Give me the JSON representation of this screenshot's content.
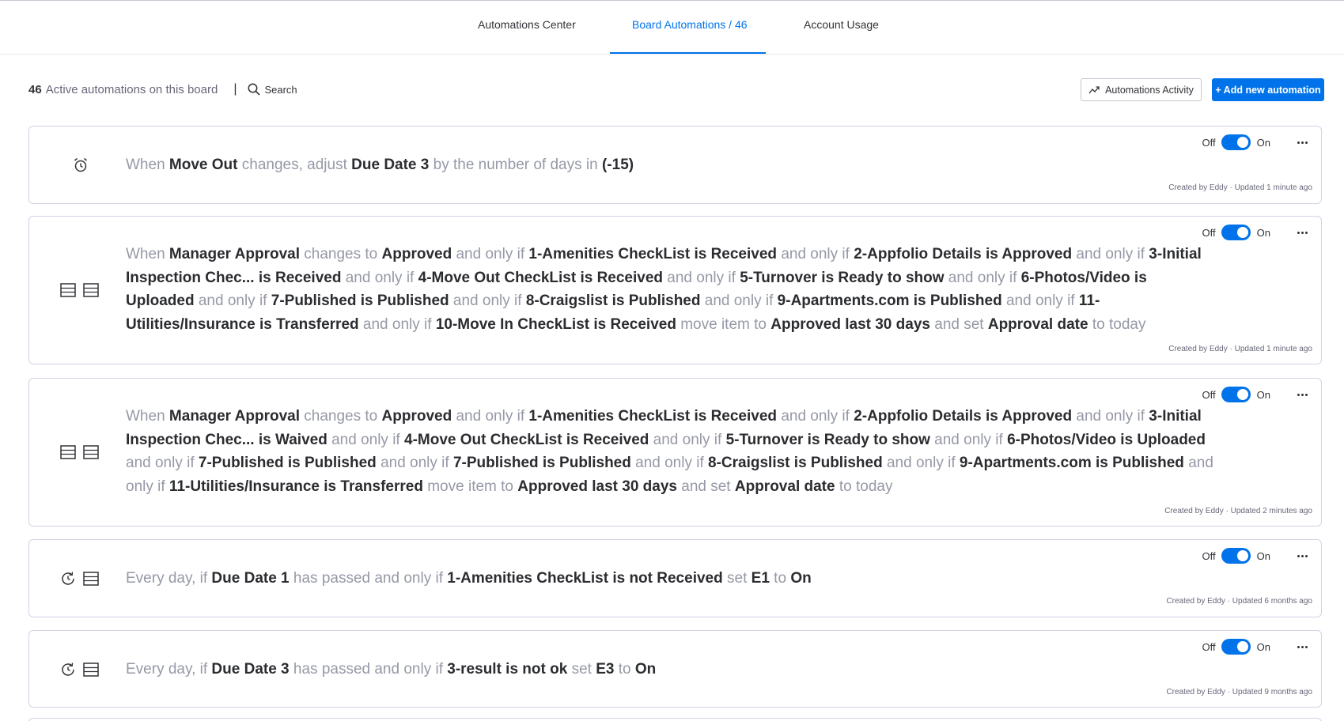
{
  "tabs": [
    {
      "label": "Automations Center"
    },
    {
      "label": "Board Automations / 46"
    },
    {
      "label": "Account Usage"
    }
  ],
  "toolbar": {
    "count": "46",
    "count_text": "Active automations on this board",
    "separator": "|",
    "search_label": "Search",
    "activity_label": "Automations Activity",
    "add_label": "+ Add new automation"
  },
  "toggle": {
    "off_label": "Off",
    "on_label": "On"
  },
  "colors": {
    "accent": "#0073ea",
    "text": "#323338",
    "muted": "#9699a6",
    "border": "#d0d4e4"
  },
  "automations": [
    {
      "icons": [
        "alarm-clock-icon"
      ],
      "enabled": true,
      "sentence": [
        [
          "tx",
          "When"
        ],
        [
          "kw",
          "Move Out"
        ],
        [
          "tx",
          "changes, adjust"
        ],
        [
          "kw",
          "Due Date 3"
        ],
        [
          "tx",
          "by the number of days in"
        ],
        [
          "kw",
          "(-15)"
        ]
      ],
      "meta": "Created by Eddy · Updated 1 minute ago"
    },
    {
      "icons": [
        "board-icon",
        "board-icon"
      ],
      "enabled": true,
      "sentence": [
        [
          "tx",
          "When"
        ],
        [
          "kw",
          "Manager Approval"
        ],
        [
          "tx",
          "changes to"
        ],
        [
          "kw",
          "Approved"
        ],
        [
          "tx",
          "and only if"
        ],
        [
          "kw",
          "1-Amenities CheckList  is  Received"
        ],
        [
          "tx",
          "and only if"
        ],
        [
          "kw",
          "2-Appfolio Details  is  Approved"
        ],
        [
          "tx",
          "and only if"
        ],
        [
          "kw",
          "3-Initial Inspection Chec...   is  Received"
        ],
        [
          "tx",
          "and only if"
        ],
        [
          "kw",
          "4-Move Out CheckList  is  Received"
        ],
        [
          "tx",
          "and only if"
        ],
        [
          "kw",
          "5-Turnover  is  Ready to show"
        ],
        [
          "tx",
          "and only if"
        ],
        [
          "kw",
          "6-Photos/Video  is  Uploaded"
        ],
        [
          "tx",
          "and only if"
        ],
        [
          "kw",
          "7-Published  is  Published"
        ],
        [
          "tx",
          "and only if"
        ],
        [
          "kw",
          "8-Craigslist  is  Published"
        ],
        [
          "tx",
          "and only if"
        ],
        [
          "kw",
          "9-Apartments.com  is  Published"
        ],
        [
          "tx",
          "and only if"
        ],
        [
          "kw",
          "11-Utilities/Insurance  is  Transferred"
        ],
        [
          "tx",
          "and only if"
        ],
        [
          "kw",
          "10-Move In CheckList  is  Received"
        ],
        [
          "tx",
          "move item to"
        ],
        [
          "kw",
          "Approved last 30 days"
        ],
        [
          "tx",
          "and set"
        ],
        [
          "kw",
          "Approval date"
        ],
        [
          "tx",
          "to today"
        ]
      ],
      "meta": "Created by Eddy · Updated 1 minute ago"
    },
    {
      "icons": [
        "board-icon",
        "board-icon"
      ],
      "enabled": true,
      "sentence": [
        [
          "tx",
          "When"
        ],
        [
          "kw",
          "Manager Approval"
        ],
        [
          "tx",
          "changes to"
        ],
        [
          "kw",
          "Approved"
        ],
        [
          "tx",
          "and only if"
        ],
        [
          "kw",
          "1-Amenities CheckList  is  Received"
        ],
        [
          "tx",
          "and only if"
        ],
        [
          "kw",
          "2-Appfolio Details  is  Approved"
        ],
        [
          "tx",
          "and only if"
        ],
        [
          "kw",
          "3-Initial Inspection Chec...   is  Waived"
        ],
        [
          "tx",
          "and only if"
        ],
        [
          "kw",
          "4-Move Out CheckList  is  Received"
        ],
        [
          "tx",
          "and only if"
        ],
        [
          "kw",
          "5-Turnover  is  Ready to show"
        ],
        [
          "tx",
          "and only if"
        ],
        [
          "kw",
          "6-Photos/Video  is  Uploaded"
        ],
        [
          "tx",
          "and only if"
        ],
        [
          "kw",
          "7-Published  is  Published"
        ],
        [
          "tx",
          "and only if"
        ],
        [
          "kw",
          "7-Published  is  Published"
        ],
        [
          "tx",
          "and only if"
        ],
        [
          "kw",
          "8-Craigslist  is  Published"
        ],
        [
          "tx",
          "and only if"
        ],
        [
          "kw",
          "9-Apartments.com  is  Published"
        ],
        [
          "tx",
          "and only if"
        ],
        [
          "kw",
          "11-Utilities/Insurance  is  Transferred"
        ],
        [
          "tx",
          "move item to"
        ],
        [
          "kw",
          "Approved last 30 days"
        ],
        [
          "tx",
          "and set"
        ],
        [
          "kw",
          "Approval date"
        ],
        [
          "tx",
          "to today"
        ]
      ],
      "meta": "Created by Eddy · Updated 2 minutes ago"
    },
    {
      "icons": [
        "recurring-clock-icon",
        "board-icon"
      ],
      "enabled": true,
      "sentence": [
        [
          "tx",
          "Every day, if"
        ],
        [
          "kw",
          "Due Date 1"
        ],
        [
          "tx",
          "has passed and only if"
        ],
        [
          "kw",
          "1-Amenities CheckList  is not  Received"
        ],
        [
          "tx",
          "set"
        ],
        [
          "kw",
          "E1"
        ],
        [
          "tx",
          "to"
        ],
        [
          "kw",
          "On"
        ]
      ],
      "meta": "Created by Eddy · Updated 6 months ago"
    },
    {
      "icons": [
        "recurring-clock-icon",
        "board-icon"
      ],
      "enabled": true,
      "sentence": [
        [
          "tx",
          "Every day, if"
        ],
        [
          "kw",
          "Due Date 3"
        ],
        [
          "tx",
          "has passed and only if"
        ],
        [
          "kw",
          "3-result  is not  ok"
        ],
        [
          "tx",
          "set"
        ],
        [
          "kw",
          "E3"
        ],
        [
          "tx",
          "to"
        ],
        [
          "kw",
          "On"
        ]
      ],
      "meta": "Created by Eddy · Updated 9 months ago"
    }
  ]
}
